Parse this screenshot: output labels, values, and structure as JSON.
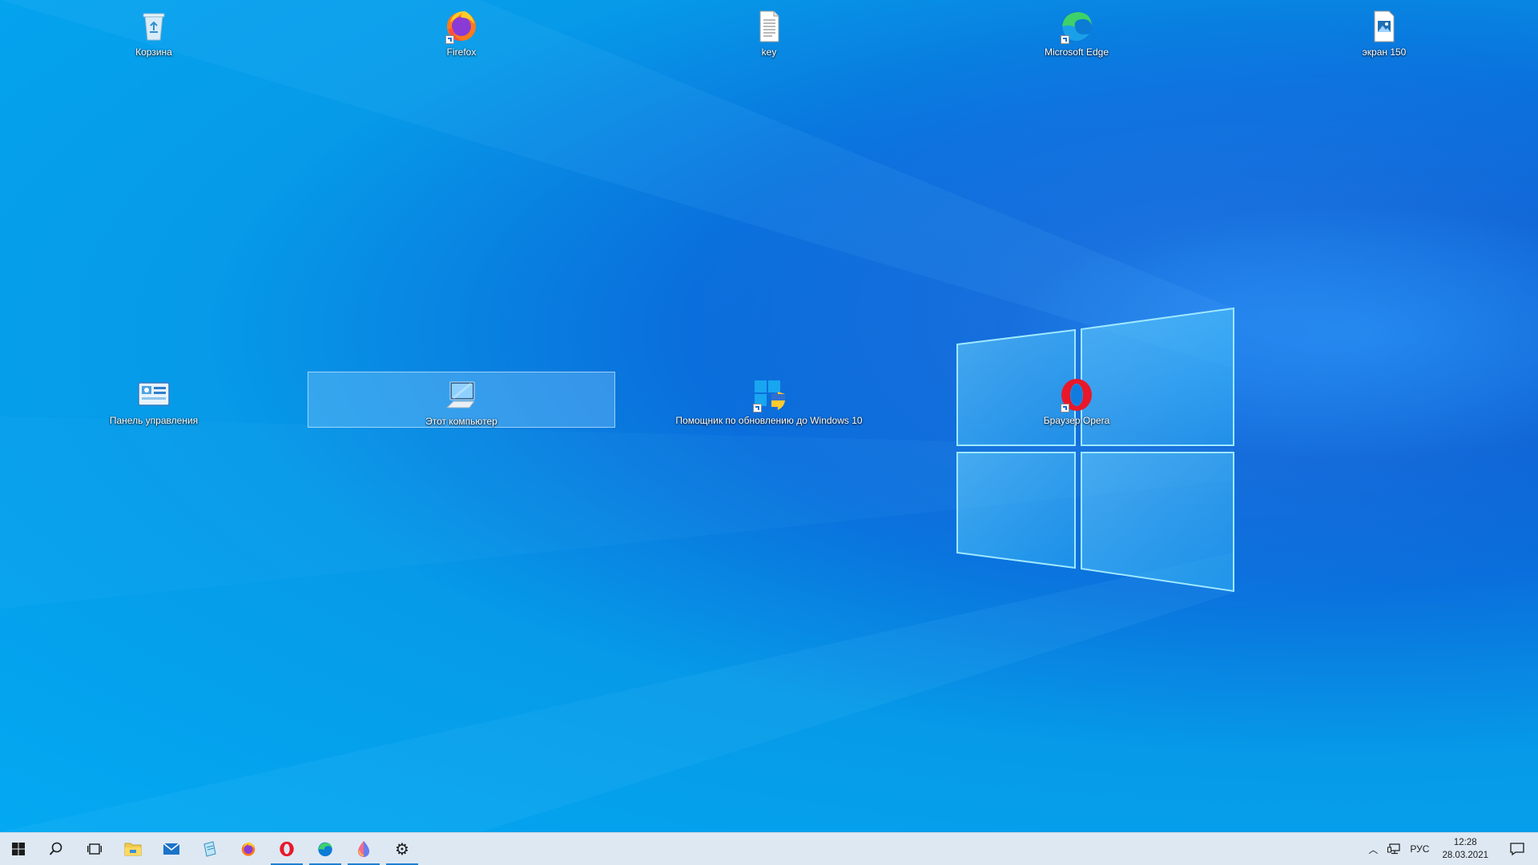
{
  "desktop": {
    "icons": [
      {
        "label": "Корзина",
        "icon": "recycle-bin-icon"
      },
      {
        "label": "Firefox",
        "icon": "firefox-icon"
      },
      {
        "label": "key",
        "icon": "text-document-icon"
      },
      {
        "label": "Microsoft Edge",
        "icon": "edge-icon"
      },
      {
        "label": "экран 150",
        "icon": "image-file-icon"
      },
      {
        "label": "Панель управления",
        "icon": "control-panel-icon"
      },
      {
        "label": "Этот компьютер",
        "icon": "this-pc-icon",
        "selected": true
      },
      {
        "label": "Помощник по обновлению до Windows 10",
        "icon": "windows-update-assistant-icon"
      },
      {
        "label": "Браузер Opera",
        "icon": "opera-icon"
      }
    ]
  },
  "taskbar": {
    "buttons": [
      {
        "name": "start-button",
        "icon": "windows-logo-icon"
      },
      {
        "name": "search-button",
        "icon": "search-icon"
      },
      {
        "name": "task-view-button",
        "icon": "task-view-icon"
      },
      {
        "name": "file-explorer-button",
        "icon": "folder-icon"
      },
      {
        "name": "mail-button",
        "icon": "mail-icon"
      },
      {
        "name": "notepad-button",
        "icon": "notepad-icon"
      },
      {
        "name": "firefox-taskbar-button",
        "icon": "firefox-icon"
      },
      {
        "name": "opera-taskbar-button",
        "icon": "opera-icon",
        "active": true
      },
      {
        "name": "edge-taskbar-button",
        "icon": "edge-icon",
        "active": true
      },
      {
        "name": "paint3d-taskbar-button",
        "icon": "paint-drop-icon",
        "active": true
      },
      {
        "name": "settings-taskbar-button",
        "icon": "gear-icon",
        "active": true
      }
    ],
    "tray": {
      "chevron_icon": "chevron-up-icon",
      "network_icon": "network-icon",
      "language": "РУС",
      "time": "12:28",
      "date": "28.03.2021",
      "notifications_icon": "action-center-icon"
    }
  },
  "colors": {
    "wallpaper_accent": "#0a6fdc",
    "taskbar_bg": "#dde8f3",
    "active_indicator": "#1f7fd0",
    "selection": "#8ccdff"
  }
}
